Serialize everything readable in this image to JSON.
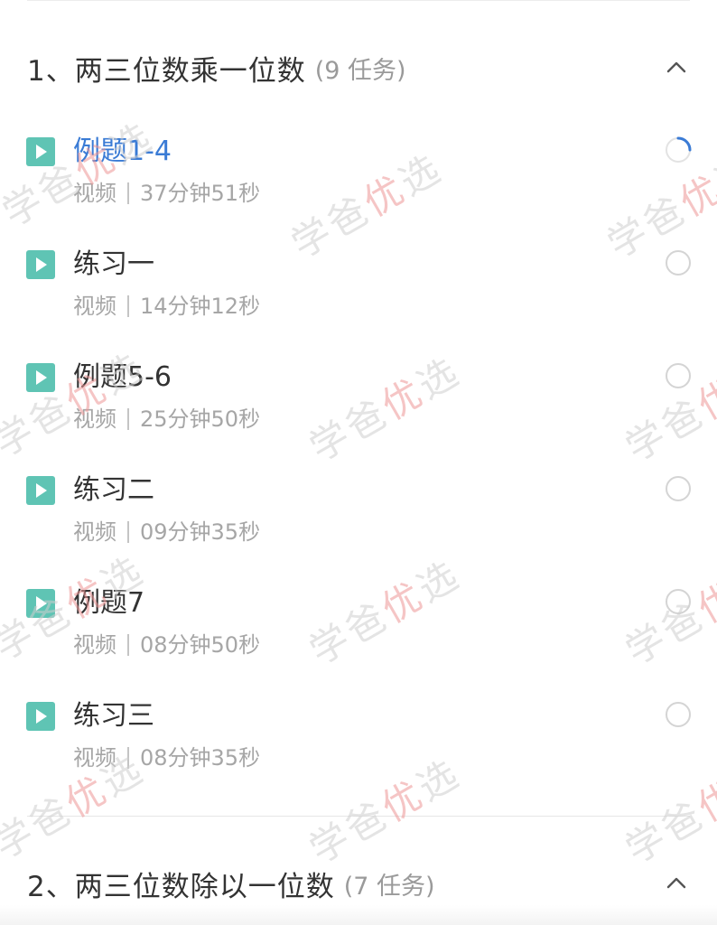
{
  "sections": [
    {
      "title": "1、两三位数乘一位数",
      "count": "(9 任务)",
      "expanded": true,
      "lessons": [
        {
          "title": "例题1-4",
          "type": "视频",
          "duration": "37分钟51秒",
          "active": true,
          "status": "loading"
        },
        {
          "title": "练习一",
          "type": "视频",
          "duration": "14分钟12秒",
          "active": false,
          "status": "not-started"
        },
        {
          "title": "例题5-6",
          "type": "视频",
          "duration": "25分钟50秒",
          "active": false,
          "status": "not-started"
        },
        {
          "title": "练习二",
          "type": "视频",
          "duration": "09分钟35秒",
          "active": false,
          "status": "not-started"
        },
        {
          "title": "例题7",
          "type": "视频",
          "duration": "08分钟50秒",
          "active": false,
          "status": "not-started"
        },
        {
          "title": "练习三",
          "type": "视频",
          "duration": "08分钟35秒",
          "active": false,
          "status": "not-started"
        }
      ]
    },
    {
      "title": "2、两三位数除以一位数",
      "count": "(7 任务)",
      "expanded": true
    }
  ],
  "watermark": {
    "part1": "学爸",
    "part2": "优",
    "part3": "选"
  },
  "colors": {
    "play_icon": "#5fc4b4",
    "active_title": "#3a7bd5",
    "spinner": "#3a7bd5"
  }
}
